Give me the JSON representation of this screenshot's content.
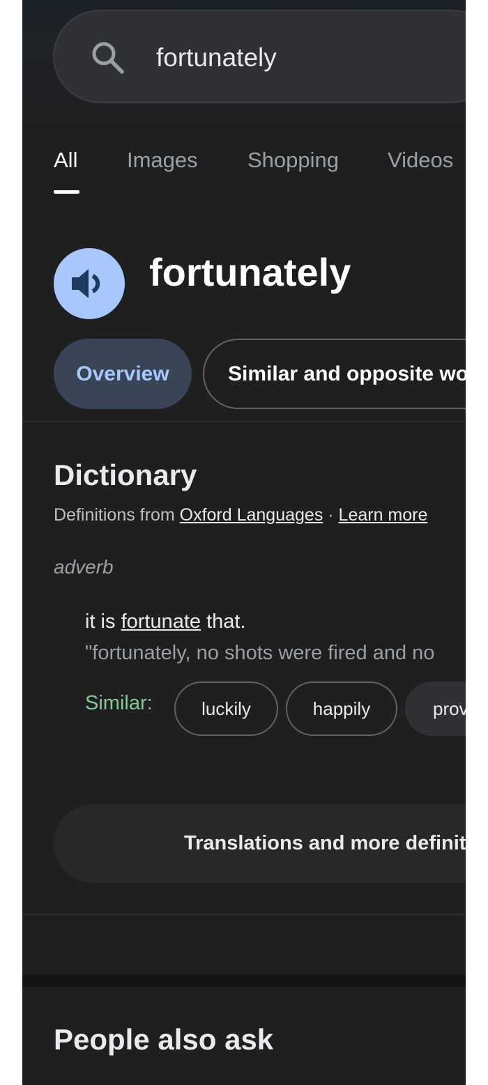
{
  "search": {
    "query": "fortunately",
    "icon": "search-icon"
  },
  "tabs": [
    {
      "label": "All",
      "active": true
    },
    {
      "label": "Images",
      "active": false
    },
    {
      "label": "Shopping",
      "active": false
    },
    {
      "label": "Videos",
      "active": false
    }
  ],
  "word": {
    "title": "fortunately",
    "pronounce_icon": "speaker-icon"
  },
  "chips": {
    "overview": "Overview",
    "similar": "Similar and opposite words"
  },
  "dictionary": {
    "heading": "Dictionary",
    "source_prefix": "Definitions from ",
    "source_link": "Oxford Languages",
    "separator": " · ",
    "learn_more": "Learn more",
    "part_of_speech": "adverb",
    "definition_prefix": "it is ",
    "definition_link": "fortunate",
    "definition_suffix": " that.",
    "example": "\"fortunately, no shots were fired and no",
    "similar_label": "Similar:",
    "similar_words": [
      "luckily",
      "happily",
      "providentially"
    ]
  },
  "translations_button": "Translations and more definitions",
  "people_also_ask": "People also ask",
  "colors": {
    "background": "#1f1f1f",
    "accent": "#a8c7fa",
    "similar_green": "#81c995"
  }
}
